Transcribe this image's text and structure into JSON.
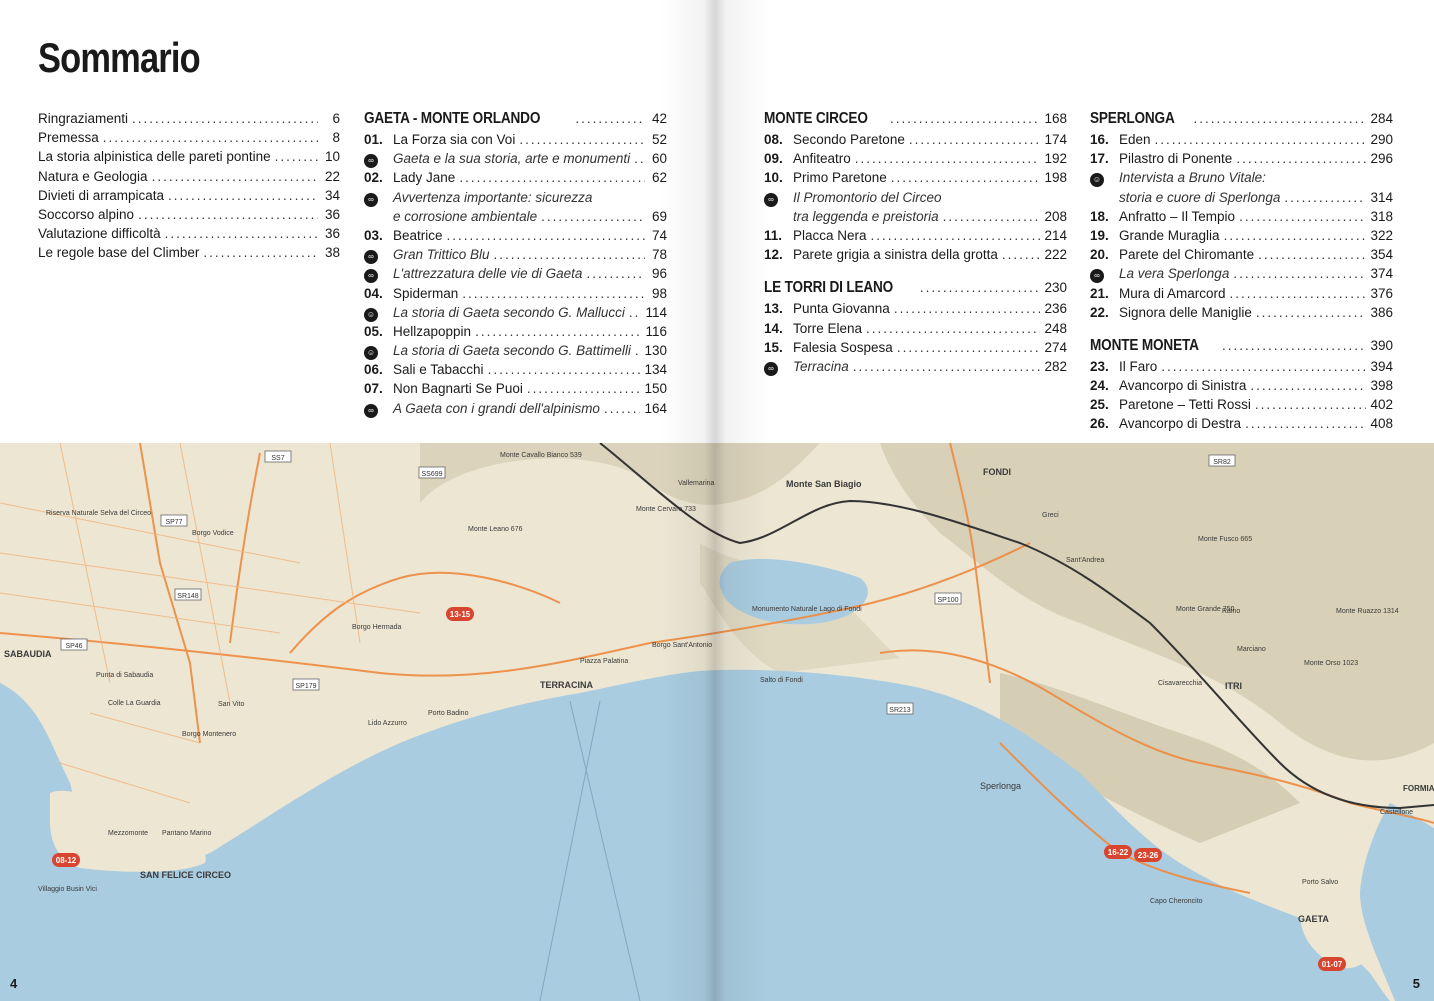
{
  "title": "Sommario",
  "columns": {
    "a": [
      {
        "label": "Ringraziamenti",
        "page": "6"
      },
      {
        "label": "Premessa",
        "page": "8"
      },
      {
        "label": "La storia alpinistica delle pareti pontine",
        "page": "10"
      },
      {
        "label": "Natura e Geologia",
        "page": "22"
      },
      {
        "label": "Divieti di arrampicata",
        "page": "34"
      },
      {
        "label": "Soccorso alpino",
        "page": "36"
      },
      {
        "label": "Valutazione difficoltà",
        "page": "36"
      },
      {
        "label": "Le regole base del Climber",
        "page": "38"
      }
    ],
    "b": [
      {
        "type": "section",
        "label": "GAETA - MONTE ORLANDO",
        "page": "42"
      },
      {
        "num": "01.",
        "label": "La Forza sia con Voi",
        "page": "52"
      },
      {
        "icon": "rope",
        "label": "Gaeta e la sua storia, arte e monumenti",
        "page": "60",
        "italic": true
      },
      {
        "num": "02.",
        "label": "Lady Jane",
        "page": "62"
      },
      {
        "icon": "rope",
        "label": "Avvertenza importante: sicurezza",
        "page": "",
        "italic": true
      },
      {
        "indent": true,
        "label": "e corrosione ambientale",
        "page": "69",
        "italic": true
      },
      {
        "num": "03.",
        "label": "Beatrice",
        "page": "74"
      },
      {
        "icon": "rope",
        "label": "Gran Trittico Blu",
        "page": "78",
        "italic": true
      },
      {
        "icon": "rope",
        "label": "L'attrezzatura delle vie di Gaeta",
        "page": "96",
        "italic": true
      },
      {
        "num": "04.",
        "label": "Spiderman",
        "page": "98"
      },
      {
        "icon": "person",
        "label": "La storia di Gaeta secondo G. Mallucci",
        "page": "114",
        "italic": true
      },
      {
        "num": "05.",
        "label": "Hellzapoppin",
        "page": "116"
      },
      {
        "icon": "person",
        "label": "La storia di Gaeta secondo G. Battimelli",
        "page": "130",
        "italic": true
      },
      {
        "num": "06.",
        "label": "Sali e Tabacchi",
        "page": "134"
      },
      {
        "num": "07.",
        "label": "Non Bagnarti Se Puoi",
        "page": "150"
      },
      {
        "icon": "rope",
        "label": "A Gaeta con i grandi dell'alpinismo",
        "page": "164",
        "italic": true
      }
    ],
    "c": [
      {
        "type": "section",
        "label": "MONTE CIRCEO",
        "page": "168"
      },
      {
        "num": "08.",
        "label": "Secondo Paretone",
        "page": "174"
      },
      {
        "num": "09.",
        "label": "Anfiteatro",
        "page": "192"
      },
      {
        "num": "10.",
        "label": "Primo Paretone",
        "page": "198"
      },
      {
        "icon": "rope",
        "label": "Il Promontorio del Circeo",
        "page": "",
        "italic": true
      },
      {
        "indent": true,
        "label": "tra leggenda e preistoria",
        "page": "208",
        "italic": true
      },
      {
        "num": "11.",
        "label": "Placca Nera",
        "page": "214"
      },
      {
        "num": "12.",
        "label": "Parete grigia a sinistra della grotta",
        "page": "222"
      },
      {
        "type": "gap"
      },
      {
        "type": "section",
        "label": "LE TORRI DI LEANO",
        "page": "230"
      },
      {
        "num": "13.",
        "label": "Punta Giovanna",
        "page": "236"
      },
      {
        "num": "14.",
        "label": "Torre Elena",
        "page": "248"
      },
      {
        "num": "15.",
        "label": "Falesia Sospesa",
        "page": "274"
      },
      {
        "icon": "rope",
        "label": "Terracina",
        "page": "282",
        "italic": true
      }
    ],
    "d": [
      {
        "type": "section",
        "label": "SPERLONGA",
        "page": "284"
      },
      {
        "num": "16.",
        "label": "Eden",
        "page": "290"
      },
      {
        "num": "17.",
        "label": "Pilastro di Ponente",
        "page": "296"
      },
      {
        "icon": "person",
        "label": "Intervista a Bruno Vitale:",
        "page": "",
        "italic": true
      },
      {
        "indent": true,
        "label": "storia e cuore di Sperlonga",
        "page": "314",
        "italic": true
      },
      {
        "num": "18.",
        "label": "Anfratto – Il Tempio",
        "page": "318"
      },
      {
        "num": "19.",
        "label": "Grande Muraglia",
        "page": "322"
      },
      {
        "num": "20.",
        "label": "Parete del Chiromante",
        "page": "354"
      },
      {
        "icon": "rope",
        "label": "La vera Sperlonga",
        "page": "374",
        "italic": true
      },
      {
        "num": "21.",
        "label": "Mura di Amarcord",
        "page": "376"
      },
      {
        "num": "22.",
        "label": "Signora delle Maniglie",
        "page": "386"
      },
      {
        "type": "gap"
      },
      {
        "type": "section",
        "label": "MONTE MONETA",
        "page": "390"
      },
      {
        "num": "23.",
        "label": "Il Faro",
        "page": "394"
      },
      {
        "num": "24.",
        "label": "Avancorpo di Sinistra",
        "page": "398"
      },
      {
        "num": "25.",
        "label": "Paretone – Tetti Rossi",
        "page": "402"
      },
      {
        "num": "26.",
        "label": "Avancorpo di Destra",
        "page": "408"
      }
    ]
  },
  "map": {
    "places": [
      "TERRACINA",
      "SABAUDIA",
      "SAN FELICE CIRCEO",
      "Sperlonga",
      "GAETA",
      "FONDI",
      "ITRI",
      "FORMIA",
      "Monte San Biagio",
      "Riserva Naturale Selva del Circeo",
      "Monumento Naturale Lago di Fondi",
      "Villaggio Busin Vici",
      "Mezzomonte",
      "Pantano Marino",
      "Borgo Hermada",
      "Piazza Palatina",
      "Borgo Sant'Antonio",
      "Salto di Fondi",
      "Lido Azzurro",
      "Porto Badino",
      "San Vito",
      "Borgo Montenero",
      "Punta di Sabaudia",
      "Colle La Guardia",
      "Borgo Vodice",
      "Sant'Andrea",
      "Marciano",
      "Cisavarecchia",
      "Castellone",
      "Porto Salvo",
      "Monte Leano 676",
      "Monte Cavallo Bianco 539",
      "Monte Cervaro 733",
      "Monte Grande 750",
      "Monte Ruazzo 1314",
      "Monte Fusco 665",
      "Monte Orso 1023",
      "Raino",
      "Greci",
      "Vallemarina",
      "Capo Cheroncito"
    ],
    "badges": [
      "13-15",
      "08-12",
      "16-22",
      "23-26",
      "01-07"
    ],
    "roads": [
      "SS7",
      "SS699",
      "SP77",
      "SR148",
      "SP46",
      "SP179",
      "SR213",
      "SP100",
      "SR82"
    ]
  },
  "folio": {
    "left": "4",
    "right": "5"
  },
  "colors": {
    "sea": "#a9cce0",
    "land": "#ede7d6",
    "road": "#ee8a3f",
    "badge": "#d8462f"
  }
}
